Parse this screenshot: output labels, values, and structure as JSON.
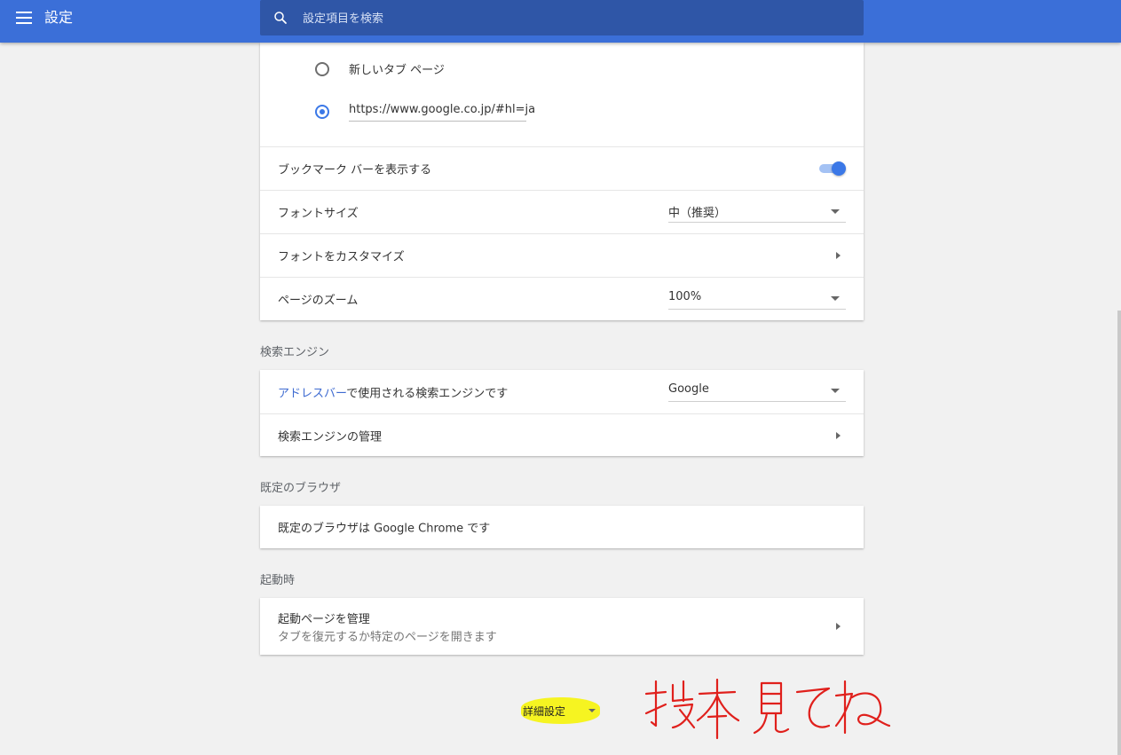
{
  "colors": {
    "brand": "#3b6fd8",
    "accent": "#3b78e7",
    "link": "#3e6bd1",
    "highlight": "#f6f421",
    "annotation": "#e0201c"
  },
  "header": {
    "title": "設定",
    "search_placeholder": "設定項目を検索",
    "menu_icon": "hamburger-menu-icon",
    "search_icon": "search-icon"
  },
  "startup_options": [
    {
      "label": "新しいタブ ページ",
      "checked": false
    },
    {
      "label": "https://www.google.co.jp/#hl=ja",
      "checked": true
    }
  ],
  "appearance": {
    "bookmark_bar_label": "ブックマーク バーを表示する",
    "bookmark_bar_on": true,
    "font_size_label": "フォントサイズ",
    "font_size_value": "中（推奨）",
    "customize_fonts_label": "フォントをカスタマイズ",
    "page_zoom_label": "ページのズーム",
    "page_zoom_value": "100%"
  },
  "search_engine": {
    "section_title": "検索エンジン",
    "address_bar_link": "アドレスバー",
    "address_bar_rest": "で使用される検索エンジンです",
    "engine_value": "Google",
    "manage_label": "検索エンジンの管理"
  },
  "default_browser": {
    "section_title": "既定のブラウザ",
    "status_prefix": "既定のブラウザは",
    "status_browser": "Google Chrome",
    "status_suffix": "です"
  },
  "on_startup": {
    "section_title": "起動時",
    "manage_label": "起動ページを管理",
    "manage_sublabel": "タブを復元するか特定のページを開きます"
  },
  "advanced": {
    "label": "詳細設定"
  },
  "annotation": {
    "text": "抜本見てね"
  }
}
